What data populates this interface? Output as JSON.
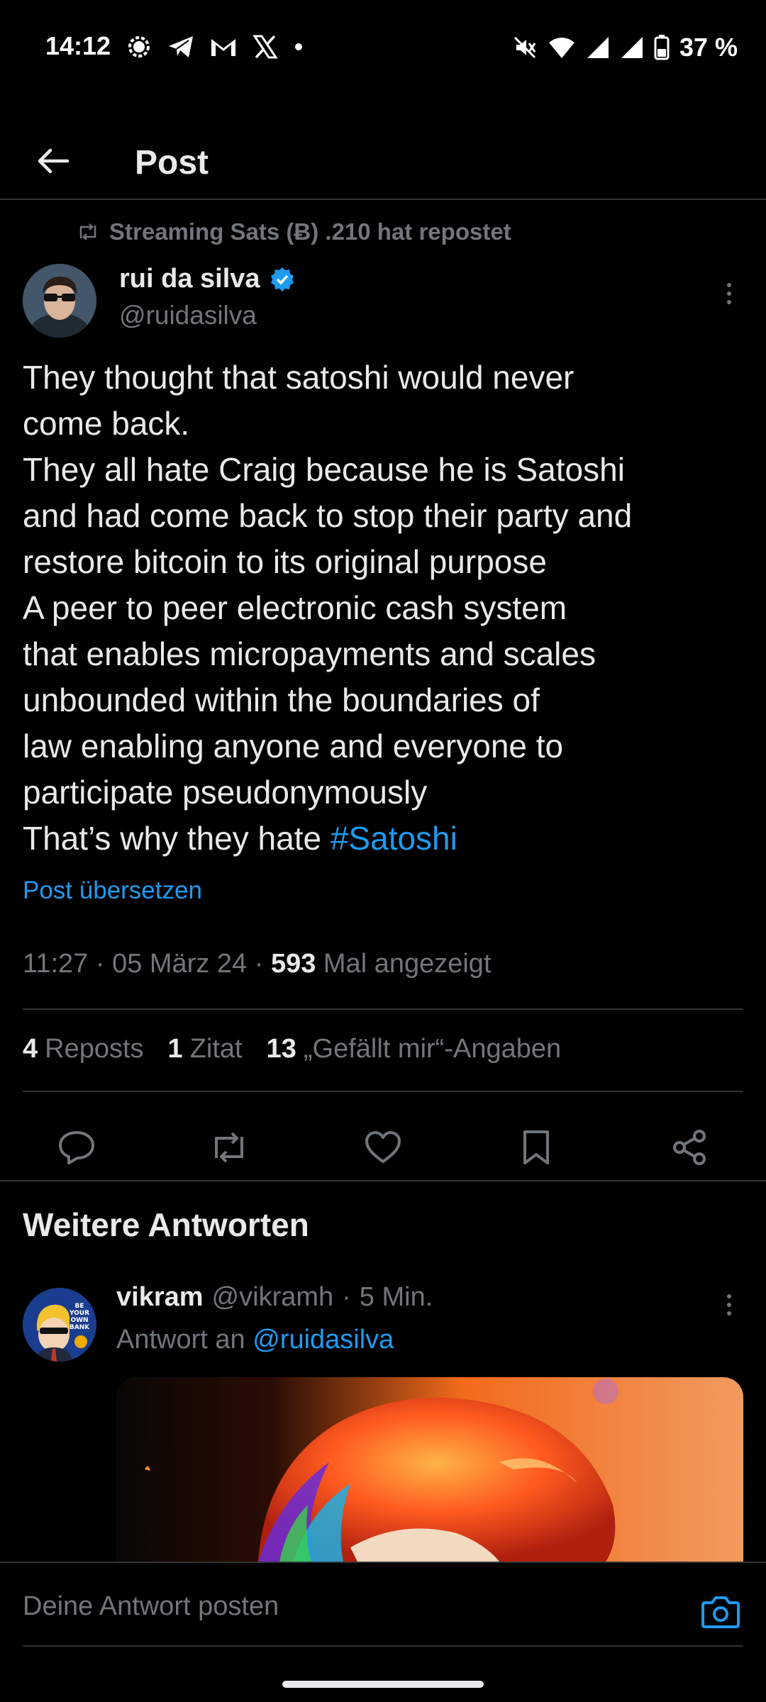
{
  "status_bar": {
    "time": "14:12",
    "battery": "37 %",
    "icons_left": [
      "signal-app-icon",
      "telegram-icon",
      "gmail-icon",
      "x-icon",
      "dot-icon"
    ],
    "icons_right": [
      "mute-icon",
      "wifi-icon",
      "cell-signal-icon",
      "cell-signal-icon",
      "battery-icon"
    ]
  },
  "header": {
    "title": "Post"
  },
  "post": {
    "repost_text": "Streaming Sats (Ƀ) .210 hat repostet",
    "author_name": "rui da silva",
    "author_handle": "@ruidasilva",
    "text_main": "They thought that satoshi would never\ncome back.\nThey all hate Craig because he is Satoshi\nand had come back to stop their party and\nrestore bitcoin to its original purpose\nA peer to peer electronic cash system\nthat enables micropayments and scales\nunbounded within the boundaries of\nlaw enabling anyone and everyone to\nparticipate pseudonymously\nThat’s why they hate ",
    "hashtag": "#Satoshi",
    "translate": "Post übersetzen",
    "time": "11:27",
    "date": "05 März 24",
    "views": "593",
    "views_label": "Mal angezeigt",
    "reposts_count": "4",
    "reposts_label": "Reposts",
    "quotes_count": "1",
    "quotes_label": "Zitat",
    "likes_count": "13",
    "likes_label": "„Gefällt mir“-Angaben"
  },
  "replies": {
    "heading": "Weitere Antworten",
    "items": [
      {
        "name": "vikram",
        "handle": "@vikramh",
        "time": "5 Min.",
        "reply_to_label": "Antwort an",
        "reply_to_handle": "@ruidasilva",
        "avatar_badge": "BE YOUR OWN BANK"
      }
    ]
  },
  "composer": {
    "placeholder": "Deine Antwort posten"
  },
  "colors": {
    "accent": "#1d9bf0",
    "text": "#e7e9ea",
    "muted": "#71767b",
    "divider": "#2f3336"
  }
}
